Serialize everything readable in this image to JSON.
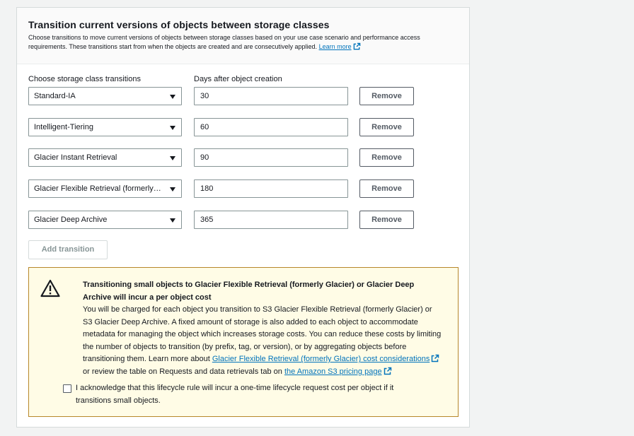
{
  "section": {
    "title": "Transition current versions of objects between storage classes",
    "description": "Choose transitions to move current versions of objects between storage classes based on your use case scenario and performance access requirements. These transitions start from when the objects are created and are consecutively applied.",
    "learn_more": "Learn more"
  },
  "columns": {
    "storage_class": "Choose storage class transitions",
    "days": "Days after object creation"
  },
  "transitions": [
    {
      "storage_class": "Standard-IA",
      "days": "30",
      "remove_label": "Remove"
    },
    {
      "storage_class": "Intelligent-Tiering",
      "days": "60",
      "remove_label": "Remove"
    },
    {
      "storage_class": "Glacier Instant Retrieval",
      "days": "90",
      "remove_label": "Remove"
    },
    {
      "storage_class": "Glacier Flexible Retrieval (formerly Glacier)",
      "days": "180",
      "remove_label": "Remove"
    },
    {
      "storage_class": "Glacier Deep Archive",
      "days": "365",
      "remove_label": "Remove"
    }
  ],
  "add_transition_label": "Add transition",
  "warning": {
    "title": "Transitioning small objects to Glacier Flexible Retrieval (formerly Glacier) or Glacier Deep Archive will incur a per object cost",
    "body": "You will be charged for each object you transition to S3 Glacier Flexible Retrieval (formerly Glacier) or S3 Glacier Deep Archive. A fixed amount of storage is also added to each object to accommodate metadata for managing the object which increases storage costs. You can reduce these costs by limiting the number of objects to transition (by prefix, tag, or version), or by aggregating objects before transitioning them. Learn more about",
    "link1": "Glacier Flexible Retrieval (formerly Glacier) cost considerations",
    "middle": "or review the table on Requests and data retrievals tab on",
    "link2": "the Amazon S3 pricing page",
    "acknowledge": "I acknowledge that this lifecycle rule will incur a one-time lifecycle request cost per object if it transitions small objects.",
    "acknowledged": false
  },
  "colors": {
    "link": "#0073bb",
    "warning_border": "#b7872a",
    "warning_bg": "#fffce6"
  }
}
